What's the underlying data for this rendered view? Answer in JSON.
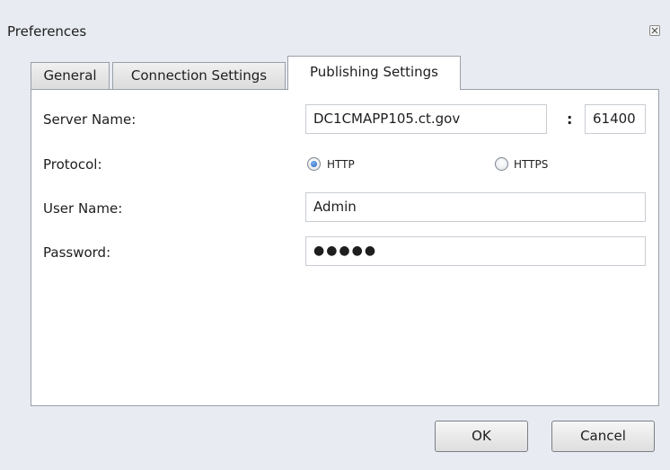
{
  "window": {
    "title": "Preferences",
    "close_icon": "close-icon"
  },
  "tabs": [
    {
      "label": "General",
      "active": false
    },
    {
      "label": "Connection Settings",
      "active": false
    },
    {
      "label": "Publishing Settings",
      "active": true
    }
  ],
  "form": {
    "server_name": {
      "label": "Server Name:",
      "value": "DC1CMAPP105.ct.gov",
      "separator": ":",
      "port": "61400"
    },
    "protocol": {
      "label": "Protocol:",
      "options": [
        {
          "label": "HTTP",
          "selected": true
        },
        {
          "label": "HTTPS",
          "selected": false
        }
      ]
    },
    "user_name": {
      "label": "User Name:",
      "value": "Admin"
    },
    "password": {
      "label": "Password:",
      "value": "●●●●●"
    }
  },
  "buttons": {
    "ok": "OK",
    "cancel": "Cancel"
  },
  "colors": {
    "window_bg": "#e8ebf1",
    "panel_bg": "#ffffff",
    "accent": "#1f5fb4"
  }
}
